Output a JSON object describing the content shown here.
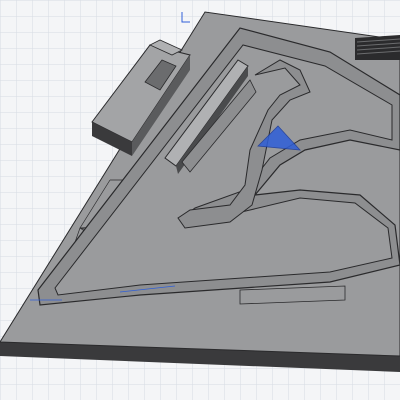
{
  "viewport": {
    "type": "3d-cad-viewport",
    "grid": true,
    "background_color": "#f4f5f7",
    "grid_color": "#d6dbe3",
    "model": {
      "description_icon": "race-track-model",
      "base_top_color": "#9a9b9d",
      "base_side_color": "#3a3a3c",
      "track_color": "#8d8e90",
      "edge_color": "#2a2a2c",
      "selection_color": "#2f5fd8"
    }
  }
}
